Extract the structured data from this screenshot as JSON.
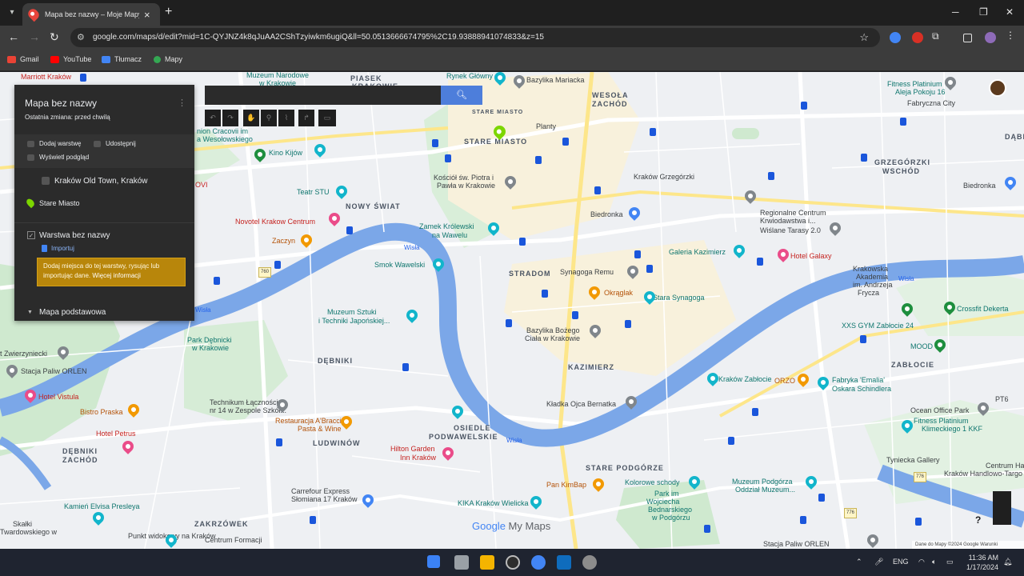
{
  "browser": {
    "tab_title": "Mapa bez nazwy – Moje Mapy",
    "url": "google.com/maps/d/edit?mid=1C-QYJNZ4k8qJuAA2CShTzyiwkm6ugiQ&ll=50.0513666674795%2C19.93888941074833&z=15",
    "bookmarks": [
      "Gmail",
      "YouTube",
      "Tłumacz",
      "Mapy"
    ]
  },
  "panel": {
    "title": "Mapa bez nazwy",
    "subtitle": "Ostatnia zmiana: przed chwilą",
    "actions": {
      "add_layer": "Dodaj warstwę",
      "share": "Udostępnij",
      "preview": "Wyświetl podgląd"
    },
    "layer1": {
      "name": "Kraków Old Town, Kraków",
      "place": "Stare Miasto"
    },
    "layer2": {
      "name": "Warstwa bez nazwy",
      "import": "Importuj",
      "hint": "Dodaj miejsca do tej warstwy, rysując lub importując dane.",
      "hint_link": "Więcej informacji"
    },
    "base_map": "Mapa podstawowa"
  },
  "map": {
    "labels": {
      "piasek": "PIASEK",
      "krakowie": "KRAKOWIE",
      "stare_miasto_top": "STARE MIASTO",
      "stare_miasto": "STARE MIASTO",
      "wesola": "WESOŁA",
      "zachod": "ZACHÓD",
      "grzegorzki_w": "GRZEGÓRZKI",
      "wschod": "WSCHÓD",
      "dabie": "DĄBI",
      "nowy_swiat": "NOWY ŚWIAT",
      "stradom": "STRADOM",
      "kazimierz": "KAZIMIERZ",
      "debniki": "DĘBNIKI",
      "debniki_zachod_1": "DĘBNIKI",
      "debniki_zachod_2": "ZACHÓD",
      "osiedle_1": "OSIEDLE",
      "osiedle_2": "PODWAWELSKIE",
      "ludwinow": "LUDWINÓW",
      "zablocie": "ZABŁOCIE",
      "stare_podgorze": "STARE PODGÓRZE",
      "zakrzowek": "ZAKRZÓWEK",
      "marriott": "Marriott Kraków",
      "muzeum_narodowe": "Muzeum Narodowe",
      "muzeum_narodowe2": "w Krakowie",
      "rynek": "Rynek Główny",
      "bazylika": "Bazylika Mariacka",
      "fitness1": "Fitness Platinium",
      "fitness1b": "Aleja Pokoju 16",
      "fabryczna": "Fabryczna City",
      "cracovia": "nion Cracovii im",
      "cracovia2": "a Wesołowskiego",
      "kino": "Kino Kijów",
      "kosciol": "Kościół św. Piotra i",
      "kosciol2": "Pawła w Krakowie",
      "plac": "Planty",
      "krakow_grzeg": "Kraków Grzegórzki",
      "bierdronka": "Biedronka",
      "regionalne": "Regionalne Centrum",
      "regionalne2": "Krwiodawstwa i...",
      "wislane": "Wiślane Tarasy 2.0",
      "bierdronka2": "Biedronka",
      "teatr": "Teatr STU",
      "novotel": "Novotel Krakow Centrum",
      "zaczyn": "Zaczyn",
      "zamek": "Zamek Królewski",
      "zamek2": "na Wawelu",
      "smok": "Smok Wawelski",
      "synagoga": "Synagoga Remu",
      "okraglak": "Okrąglak",
      "stara_syn": "Stara Synagoga",
      "galeria": "Galeria Kazimierz",
      "hotel_galaxy": "Hotel Galaxy",
      "akademia": "Krakowska",
      "akademia2": "Akademia",
      "akademia3": "im. Andrzeja",
      "akademia4": "Frycza",
      "crossfit": "Crossfit Dekerta",
      "xxs": "XXS GYM Zabłocie 24",
      "mood": "MOOD",
      "muzeum_sztuki": "Muzeum Sztuki",
      "muzeum_sztuki2": "i Techniki Japońskiej...",
      "bazylika_bozego": "Bazylika Bożego",
      "bazylika_bozego2": "Ciała w Krakowie",
      "park": "Park Dębnicki",
      "park2": "w Krakowie",
      "zwierzyniecki": "t Zwierzyniecki",
      "orlen": "Stacja Paliw ORLEN",
      "hotel_vistula": "Hotel Vistula",
      "bistro": "Bistro Praska",
      "technikum": "Technikum Łączności",
      "technikum2": "nr 14 w Zespole Szkół...",
      "restauracja": "Restauracja A'Bracciate",
      "restauracja2": "Pasta & Wine",
      "kladka": "Kładka Ojca Bernatka",
      "krakow_zab": "Kraków Zabłocie",
      "orzo": "ORZO",
      "fabryka": "Fabryka 'Emalia'",
      "fabryka2": "Oskara Schindlera",
      "fitness2": "Fitness Platinium",
      "fitness2b": "Klimeckiego 1 KKF",
      "ocean": "Ocean Office Park",
      "hotel_petrus": "Hotel Petrus",
      "hilton": "Hilton Garden",
      "hilton2": "Inn Kraków",
      "pankimbap": "Pan KimBap",
      "kolorowe": "Kolorowe schody",
      "muzeum_pod": "Muzeum Podgórza",
      "muzeum_pod2": "Oddział Muzeum...",
      "tyniecka": "Tyniecka Gallery",
      "centrum_hand": "Centrum Hand",
      "centrum_hand2": "Kraków Handlowo-Targo",
      "kamien": "Kamień Elvisa Presleya",
      "skalki": "Skałki",
      "skalki2": "Twardowskiego w",
      "carrefour": "Carrefour Express",
      "carrefour2": "Słomiana 17 Kraków",
      "kika": "KIKA Kraków Wielicka",
      "park_wojciecha": "Park im",
      "park_wojciecha2": "Wojciecha",
      "park_wojciecha3": "Bednarskiego",
      "park_wojciecha4": "w Podgórzu",
      "punkt": "Punkt widokowy na Kraków",
      "centrum_form": "Centrum Formacji",
      "stacja_orlen2": "Stacja Paliw ORLEN",
      "wisla": "Wisła",
      "wisla2": "Wisła",
      "wisla3": "Wisła",
      "wisla4": "Wisła",
      "novi": "OVI",
      "pt6": "PT6",
      "road_760": "760",
      "road_776": "776",
      "road_776b": "776"
    },
    "footer": "Dane do Mapy ©2024 Google   Warunki",
    "brand_google": "Google",
    "brand_mymaps": "My Maps",
    "search_button": "search"
  },
  "taskbar": {
    "lang": "ENG",
    "time": "11:36 AM",
    "date": "1/17/2024"
  },
  "colors": {
    "river": "#7ba7e8",
    "park": "#c9e8c9",
    "main_road": "#fde68a",
    "panel_bg": "#2b2b2b",
    "hint_bg": "#b8860b"
  }
}
